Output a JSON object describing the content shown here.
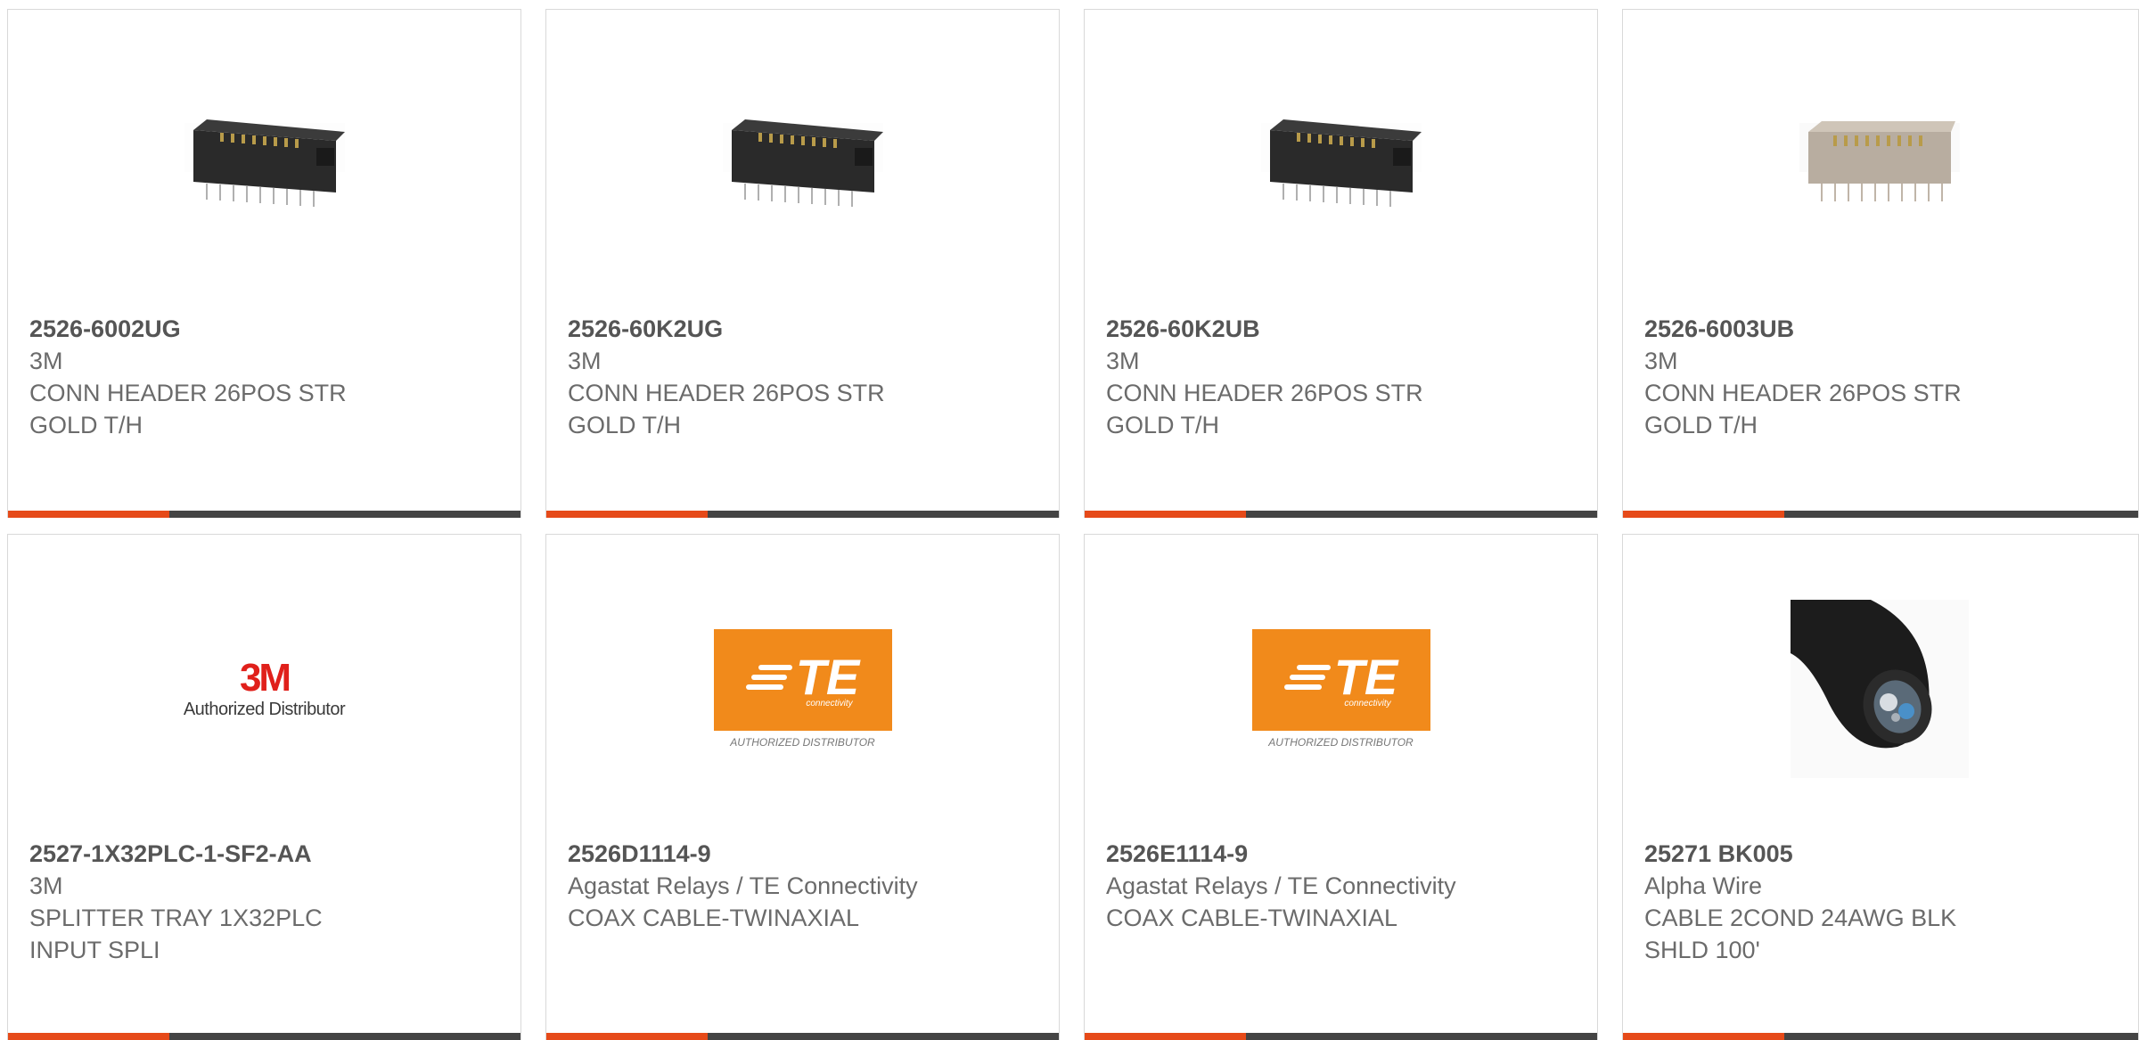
{
  "accent_color": "#e64a19",
  "bar_color": "#444444",
  "products": [
    {
      "part_number": "2526-6002UG",
      "manufacturer": "3M",
      "desc1": "CONN HEADER 26POS STR",
      "desc2": "GOLD T/H",
      "image": "header-black-connector"
    },
    {
      "part_number": "2526-60K2UG",
      "manufacturer": "3M",
      "desc1": "CONN HEADER 26POS STR",
      "desc2": "GOLD T/H",
      "image": "header-black-connector"
    },
    {
      "part_number": "2526-60K2UB",
      "manufacturer": "3M",
      "desc1": "CONN HEADER 26POS STR",
      "desc2": "GOLD T/H",
      "image": "header-black-connector"
    },
    {
      "part_number": "2526-6003UB",
      "manufacturer": "3M",
      "desc1": "CONN HEADER 26POS STR",
      "desc2": "GOLD T/H",
      "image": "header-gray-connector"
    },
    {
      "part_number": "2527-1X32PLC-1-SF2-AA",
      "manufacturer": "3M",
      "desc1": "SPLITTER TRAY 1X32PLC",
      "desc2": "INPUT SPLI",
      "image": "3m-authorized-logo",
      "logo_mark": "3M",
      "logo_text": "Authorized Distributor"
    },
    {
      "part_number": "2526D1114-9",
      "manufacturer": "Agastat Relays / TE Connectivity",
      "desc1": "COAX CABLE-TWINAXIAL",
      "desc2": "",
      "image": "te-authorized-logo",
      "logo_mark": "TE",
      "logo_sub": "connectivity",
      "logo_text": "AUTHORIZED DISTRIBUTOR"
    },
    {
      "part_number": "2526E1114-9",
      "manufacturer": "Agastat Relays / TE Connectivity",
      "desc1": "COAX CABLE-TWINAXIAL",
      "desc2": "",
      "image": "te-authorized-logo",
      "logo_mark": "TE",
      "logo_sub": "connectivity",
      "logo_text": "AUTHORIZED DISTRIBUTOR"
    },
    {
      "part_number": "25271 BK005",
      "manufacturer": "Alpha Wire",
      "desc1": "CABLE 2COND 24AWG BLK",
      "desc2": "SHLD 100'",
      "image": "black-cable"
    }
  ]
}
